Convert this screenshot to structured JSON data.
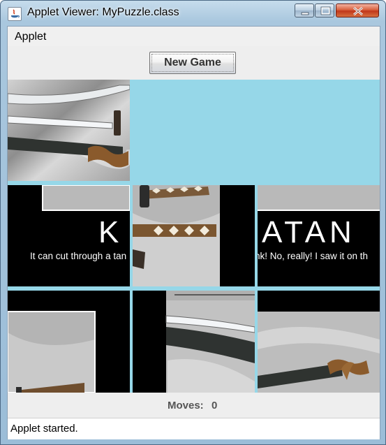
{
  "window": {
    "title": "Applet Viewer: MyPuzzle.class"
  },
  "menu": {
    "applet_label": "Applet"
  },
  "toolbar": {
    "new_game_label": "New Game"
  },
  "puzzle": {
    "tiles": [
      {
        "id": "tile-1",
        "caption_text": ""
      },
      {
        "id": "tile-2",
        "caption_text": "K",
        "subtitle_text": "It can cut through a tan"
      },
      {
        "id": "tile-3",
        "caption_text": ""
      },
      {
        "id": "tile-4",
        "caption_text": "ATAN",
        "subtitle_text": "nk!  No, really!  I saw it on th"
      },
      {
        "id": "tile-5",
        "caption_text": ""
      },
      {
        "id": "tile-6",
        "caption_text": ""
      },
      {
        "id": "tile-7",
        "caption_text": ""
      },
      {
        "id": "tile-8",
        "caption_text": ""
      }
    ],
    "empty_slot": "row 1 columns 2-3"
  },
  "moves": {
    "label": "Moves:",
    "value": "0"
  },
  "status": {
    "text": "Applet started."
  },
  "colors": {
    "board_background": "#96d7e8",
    "tile_black": "#000000",
    "silk": "#bfbfbf"
  }
}
